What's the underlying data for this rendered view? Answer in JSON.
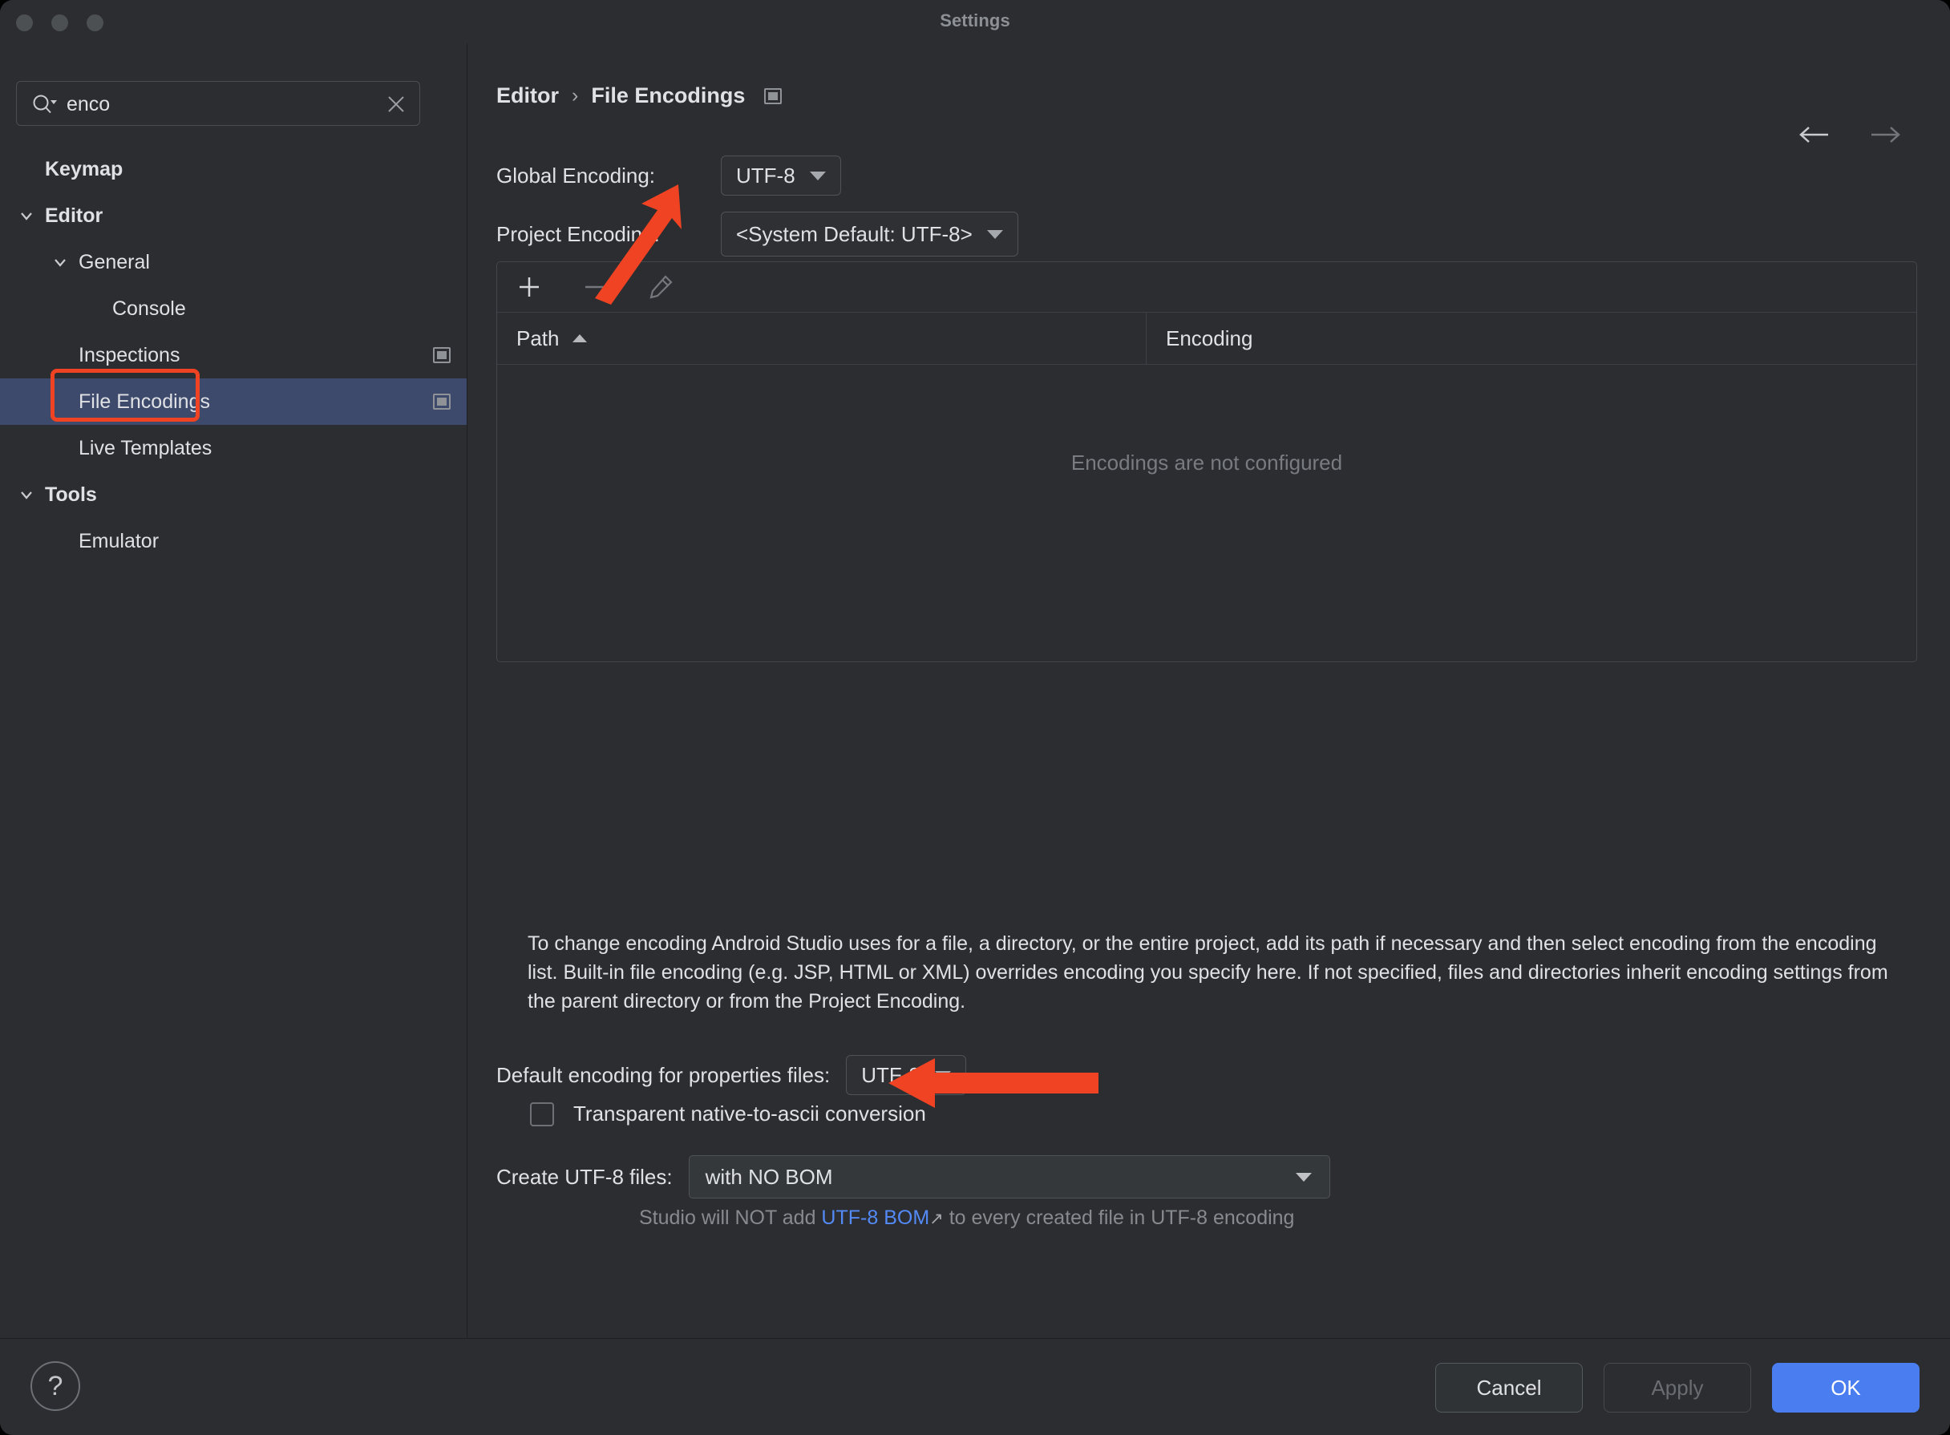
{
  "window": {
    "title": "Settings",
    "traffic_lights": [
      "close-button",
      "minimize-button",
      "zoom-button"
    ]
  },
  "sidebar": {
    "search": {
      "value": "enco",
      "placeholder": ""
    },
    "items": [
      {
        "label": "Keymap",
        "indent": 0,
        "bold": true,
        "chevron": "none",
        "selected": false,
        "scope_icon": false
      },
      {
        "label": "Editor",
        "indent": 0,
        "bold": true,
        "chevron": "down",
        "selected": false,
        "scope_icon": false
      },
      {
        "label": "General",
        "indent": 1,
        "bold": false,
        "chevron": "down",
        "selected": false,
        "scope_icon": false
      },
      {
        "label": "Console",
        "indent": 2,
        "bold": false,
        "chevron": "none",
        "selected": false,
        "scope_icon": false
      },
      {
        "label": "Inspections",
        "indent": 1,
        "bold": false,
        "chevron": "none",
        "selected": false,
        "scope_icon": true
      },
      {
        "label": "File Encodings",
        "indent": 1,
        "bold": false,
        "chevron": "none",
        "selected": true,
        "scope_icon": true
      },
      {
        "label": "Live Templates",
        "indent": 1,
        "bold": false,
        "chevron": "none",
        "selected": false,
        "scope_icon": false
      },
      {
        "label": "Tools",
        "indent": 0,
        "bold": true,
        "chevron": "down",
        "selected": false,
        "scope_icon": false
      },
      {
        "label": "Emulator",
        "indent": 1,
        "bold": false,
        "chevron": "none",
        "selected": false,
        "scope_icon": false
      }
    ]
  },
  "main": {
    "breadcrumb": {
      "parent": "Editor",
      "separator": "›",
      "current": "File Encodings"
    },
    "nav": {
      "back": "back-arrow",
      "forward": "forward-arrow"
    },
    "global_encoding": {
      "label": "Global Encoding:",
      "value": "UTF-8"
    },
    "project_encoding": {
      "label": "Project Encoding:",
      "value": "<System Default: UTF-8>"
    },
    "table": {
      "toolbar": [
        "add-icon",
        "remove-icon",
        "edit-icon"
      ],
      "columns": [
        "Path",
        "Encoding"
      ],
      "sort_column": "Path",
      "sort_direction": "ascending",
      "rows": [],
      "empty_message": "Encodings are not configured"
    },
    "description": "To change encoding Android Studio uses for a file, a directory, or the entire project, add its path if necessary and then select encoding from the encoding list. Built-in file encoding (e.g. JSP, HTML or XML) overrides encoding you specify here. If not specified, files and directories inherit encoding settings from the parent directory or from the Project Encoding.",
    "properties_encoding": {
      "label": "Default encoding for properties files:",
      "value": "UTF-8"
    },
    "transparent_conversion": {
      "label": "Transparent native-to-ascii conversion",
      "checked": false
    },
    "create_utf8": {
      "label": "Create UTF-8 files:",
      "value": "with NO BOM"
    },
    "bom_hint": {
      "prefix": "Studio will NOT add ",
      "link": "UTF-8 BOM",
      "link_arrow": "↗",
      "suffix": " to every created file in UTF-8 encoding"
    }
  },
  "footer": {
    "help": "?",
    "cancel": "Cancel",
    "apply": "Apply",
    "ok": "OK"
  },
  "colors": {
    "accent": "#4a7ef0",
    "selection": "#3d4a6b",
    "annotation": "#f04323",
    "link": "#548af7"
  }
}
